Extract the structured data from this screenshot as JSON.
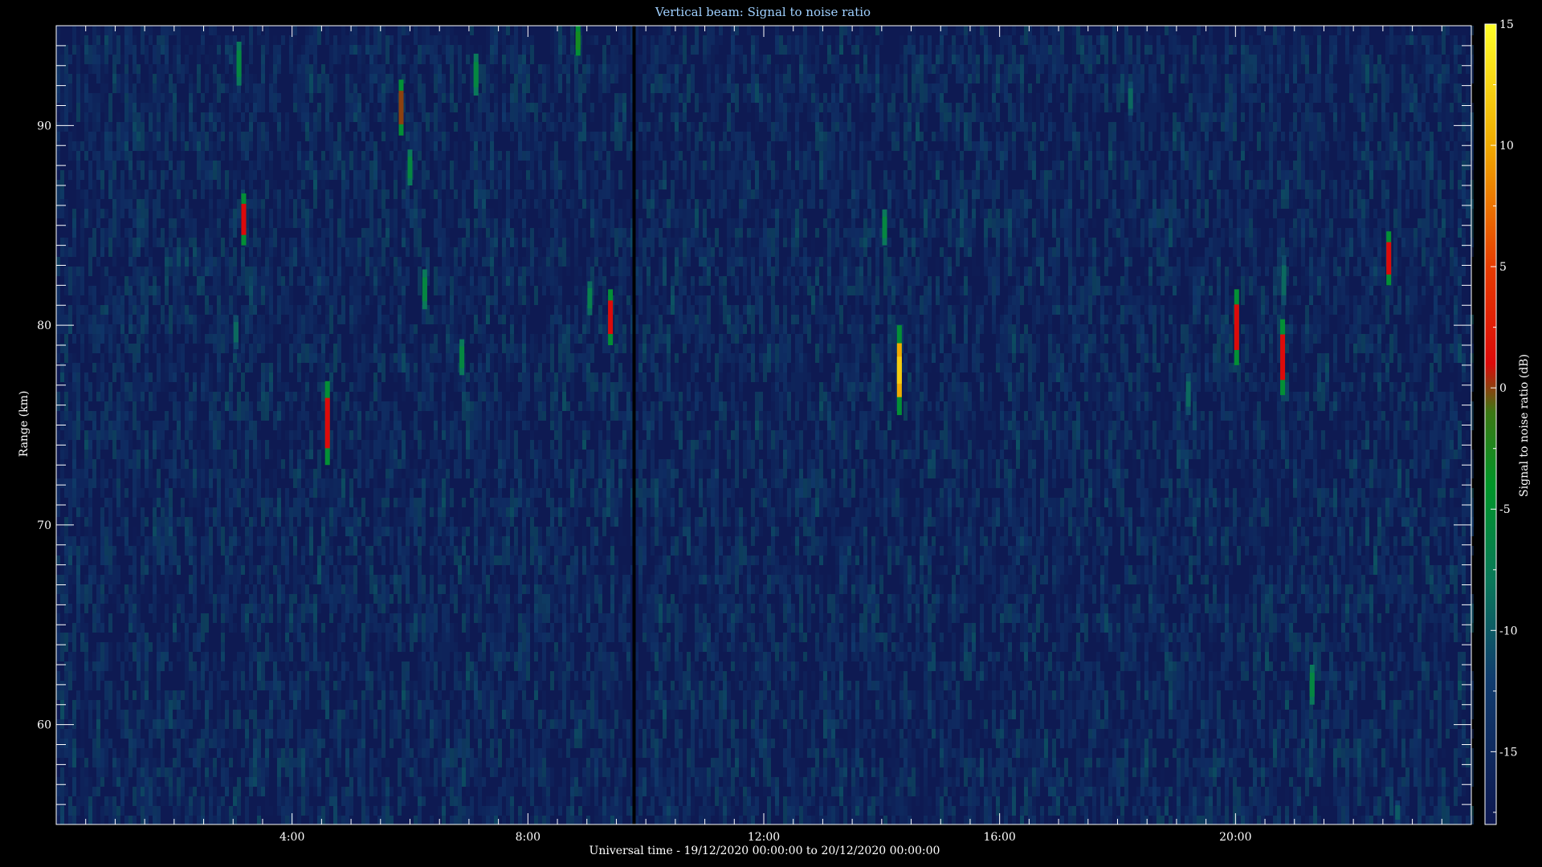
{
  "chart_data": {
    "type": "heatmap",
    "title": "Vertical beam: Signal to noise ratio",
    "xlabel": "Universal time - 19/12/2020 00:00:00 to 20/12/2020 00:00:00",
    "ylabel": "Range (km)",
    "colorbar_label": "Signal to noise ratio (dB)",
    "x_unit": "hours UT",
    "xlim": [
      0,
      24
    ],
    "ylim": [
      55,
      95
    ],
    "clim": [
      -18,
      15
    ],
    "x_ticks": [
      {
        "value": 4,
        "label": "4:00"
      },
      {
        "value": 8,
        "label": "8:00"
      },
      {
        "value": 12,
        "label": "12:00"
      },
      {
        "value": 16,
        "label": "16:00"
      },
      {
        "value": 20,
        "label": "20:00"
      }
    ],
    "y_ticks": [
      {
        "value": 60,
        "label": "60"
      },
      {
        "value": 70,
        "label": "70"
      },
      {
        "value": 80,
        "label": "80"
      },
      {
        "value": 90,
        "label": "90"
      }
    ],
    "colorbar_ticks": [
      {
        "value": 15,
        "label": "15"
      },
      {
        "value": 10,
        "label": "10"
      },
      {
        "value": 5,
        "label": "5"
      },
      {
        "value": 0,
        "label": "0"
      },
      {
        "value": -5,
        "label": "-5"
      },
      {
        "value": -10,
        "label": "-10"
      },
      {
        "value": -15,
        "label": "-15"
      }
    ],
    "background_snr_db": -17,
    "data_gap_hours": 9.8,
    "echoes": [
      {
        "t": 3.1,
        "range_min": 92.0,
        "range_max": 94.2,
        "peak_snr": -6
      },
      {
        "t": 3.18,
        "range_min": 84.0,
        "range_max": 86.6,
        "peak_snr": 1
      },
      {
        "t": 3.05,
        "range_min": 78.8,
        "range_max": 80.5,
        "peak_snr": -9
      },
      {
        "t": 4.6,
        "range_min": 73.0,
        "range_max": 77.2,
        "peak_snr": 1
      },
      {
        "t": 5.85,
        "range_min": 89.5,
        "range_max": 92.3,
        "peak_snr": 0
      },
      {
        "t": 6.0,
        "range_min": 87.0,
        "range_max": 88.8,
        "peak_snr": -6
      },
      {
        "t": 6.25,
        "range_min": 80.8,
        "range_max": 82.8,
        "peak_snr": -6
      },
      {
        "t": 6.88,
        "range_min": 77.5,
        "range_max": 79.3,
        "peak_snr": -6
      },
      {
        "t": 7.12,
        "range_min": 91.5,
        "range_max": 93.6,
        "peak_snr": -6
      },
      {
        "t": 8.85,
        "range_min": 93.5,
        "range_max": 95.0,
        "peak_snr": -3
      },
      {
        "t": 9.05,
        "range_min": 80.5,
        "range_max": 82.2,
        "peak_snr": -7
      },
      {
        "t": 9.4,
        "range_min": 79.0,
        "range_max": 81.8,
        "peak_snr": 1
      },
      {
        "t": 14.05,
        "range_min": 84.0,
        "range_max": 85.8,
        "peak_snr": -6
      },
      {
        "t": 14.3,
        "range_min": 75.5,
        "range_max": 80.0,
        "peak_snr": 10
      },
      {
        "t": 18.22,
        "range_min": 90.5,
        "range_max": 92.2,
        "peak_snr": -9
      },
      {
        "t": 19.2,
        "range_min": 75.5,
        "range_max": 77.6,
        "peak_snr": -9
      },
      {
        "t": 20.02,
        "range_min": 78.0,
        "range_max": 81.8,
        "peak_snr": 1
      },
      {
        "t": 20.8,
        "range_min": 76.5,
        "range_max": 80.3,
        "peak_snr": 1
      },
      {
        "t": 20.82,
        "range_min": 81.0,
        "range_max": 83.5,
        "peak_snr": -9
      },
      {
        "t": 21.3,
        "range_min": 61.0,
        "range_max": 63.0,
        "peak_snr": -6
      },
      {
        "t": 22.6,
        "range_min": 82.0,
        "range_max": 84.7,
        "peak_snr": 1
      },
      {
        "t": 22.75,
        "range_min": 55.0,
        "range_max": 56.2,
        "peak_snr": -10
      }
    ]
  }
}
